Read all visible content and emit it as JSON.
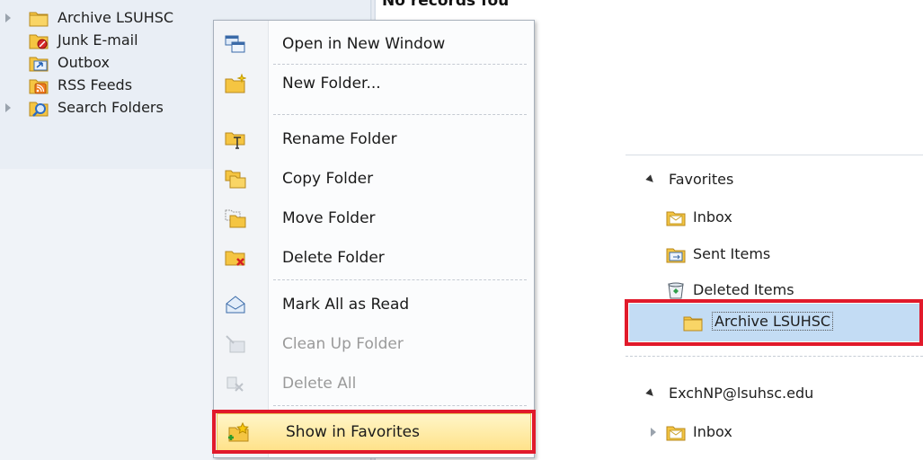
{
  "left_pane": {
    "status_text": "No records fou",
    "folders": [
      {
        "label": "Archive LSUHSC",
        "icon": "folder-icon",
        "expandable": true
      },
      {
        "label": "Junk E-mail",
        "icon": "junk-email-icon",
        "expandable": false
      },
      {
        "label": "Outbox",
        "icon": "outbox-icon",
        "expandable": false
      },
      {
        "label": "RSS Feeds",
        "icon": "rss-feeds-icon",
        "expandable": false
      },
      {
        "label": "Search Folders",
        "icon": "search-folder-icon",
        "expandable": true
      }
    ]
  },
  "context_menu": {
    "items": [
      {
        "label": "Open in New Window",
        "icon": "open-new-window-icon",
        "enabled": true
      },
      {
        "label": "New Folder...",
        "icon": "new-folder-icon",
        "enabled": true
      },
      {
        "label": "Rename Folder",
        "icon": "rename-folder-icon",
        "enabled": true
      },
      {
        "label": "Copy Folder",
        "icon": "copy-folder-icon",
        "enabled": true
      },
      {
        "label": "Move Folder",
        "icon": "move-folder-icon",
        "enabled": true
      },
      {
        "label": "Delete Folder",
        "icon": "delete-folder-icon",
        "enabled": true
      },
      {
        "label": "Mark All as Read",
        "icon": "mark-all-read-icon",
        "enabled": true
      },
      {
        "label": "Clean Up Folder",
        "icon": "clean-up-folder-icon",
        "enabled": false
      },
      {
        "label": "Delete All",
        "icon": "delete-all-icon",
        "enabled": false
      },
      {
        "label": "Show in Favorites",
        "icon": "show-in-favorites-icon",
        "enabled": true,
        "highlighted": true
      }
    ]
  },
  "favorites_pane": {
    "favorites_header": "Favorites",
    "favorites": [
      {
        "label": "Inbox",
        "icon": "inbox-icon"
      },
      {
        "label": "Sent Items",
        "icon": "sent-items-icon"
      },
      {
        "label": "Deleted Items",
        "icon": "deleted-items-icon"
      },
      {
        "label": "Archive LSUHSC",
        "icon": "folder-icon",
        "selected": true
      }
    ],
    "account_header": "ExchNP@lsuhsc.edu",
    "account_folders": [
      {
        "label": "Inbox",
        "icon": "inbox-icon",
        "expandable": true
      }
    ]
  },
  "colors": {
    "highlight_border": "#e11a2b",
    "selected_row": "#c3dcf4",
    "menu_hover": "#ffe28a",
    "folder_yellow": "#f5c542"
  }
}
